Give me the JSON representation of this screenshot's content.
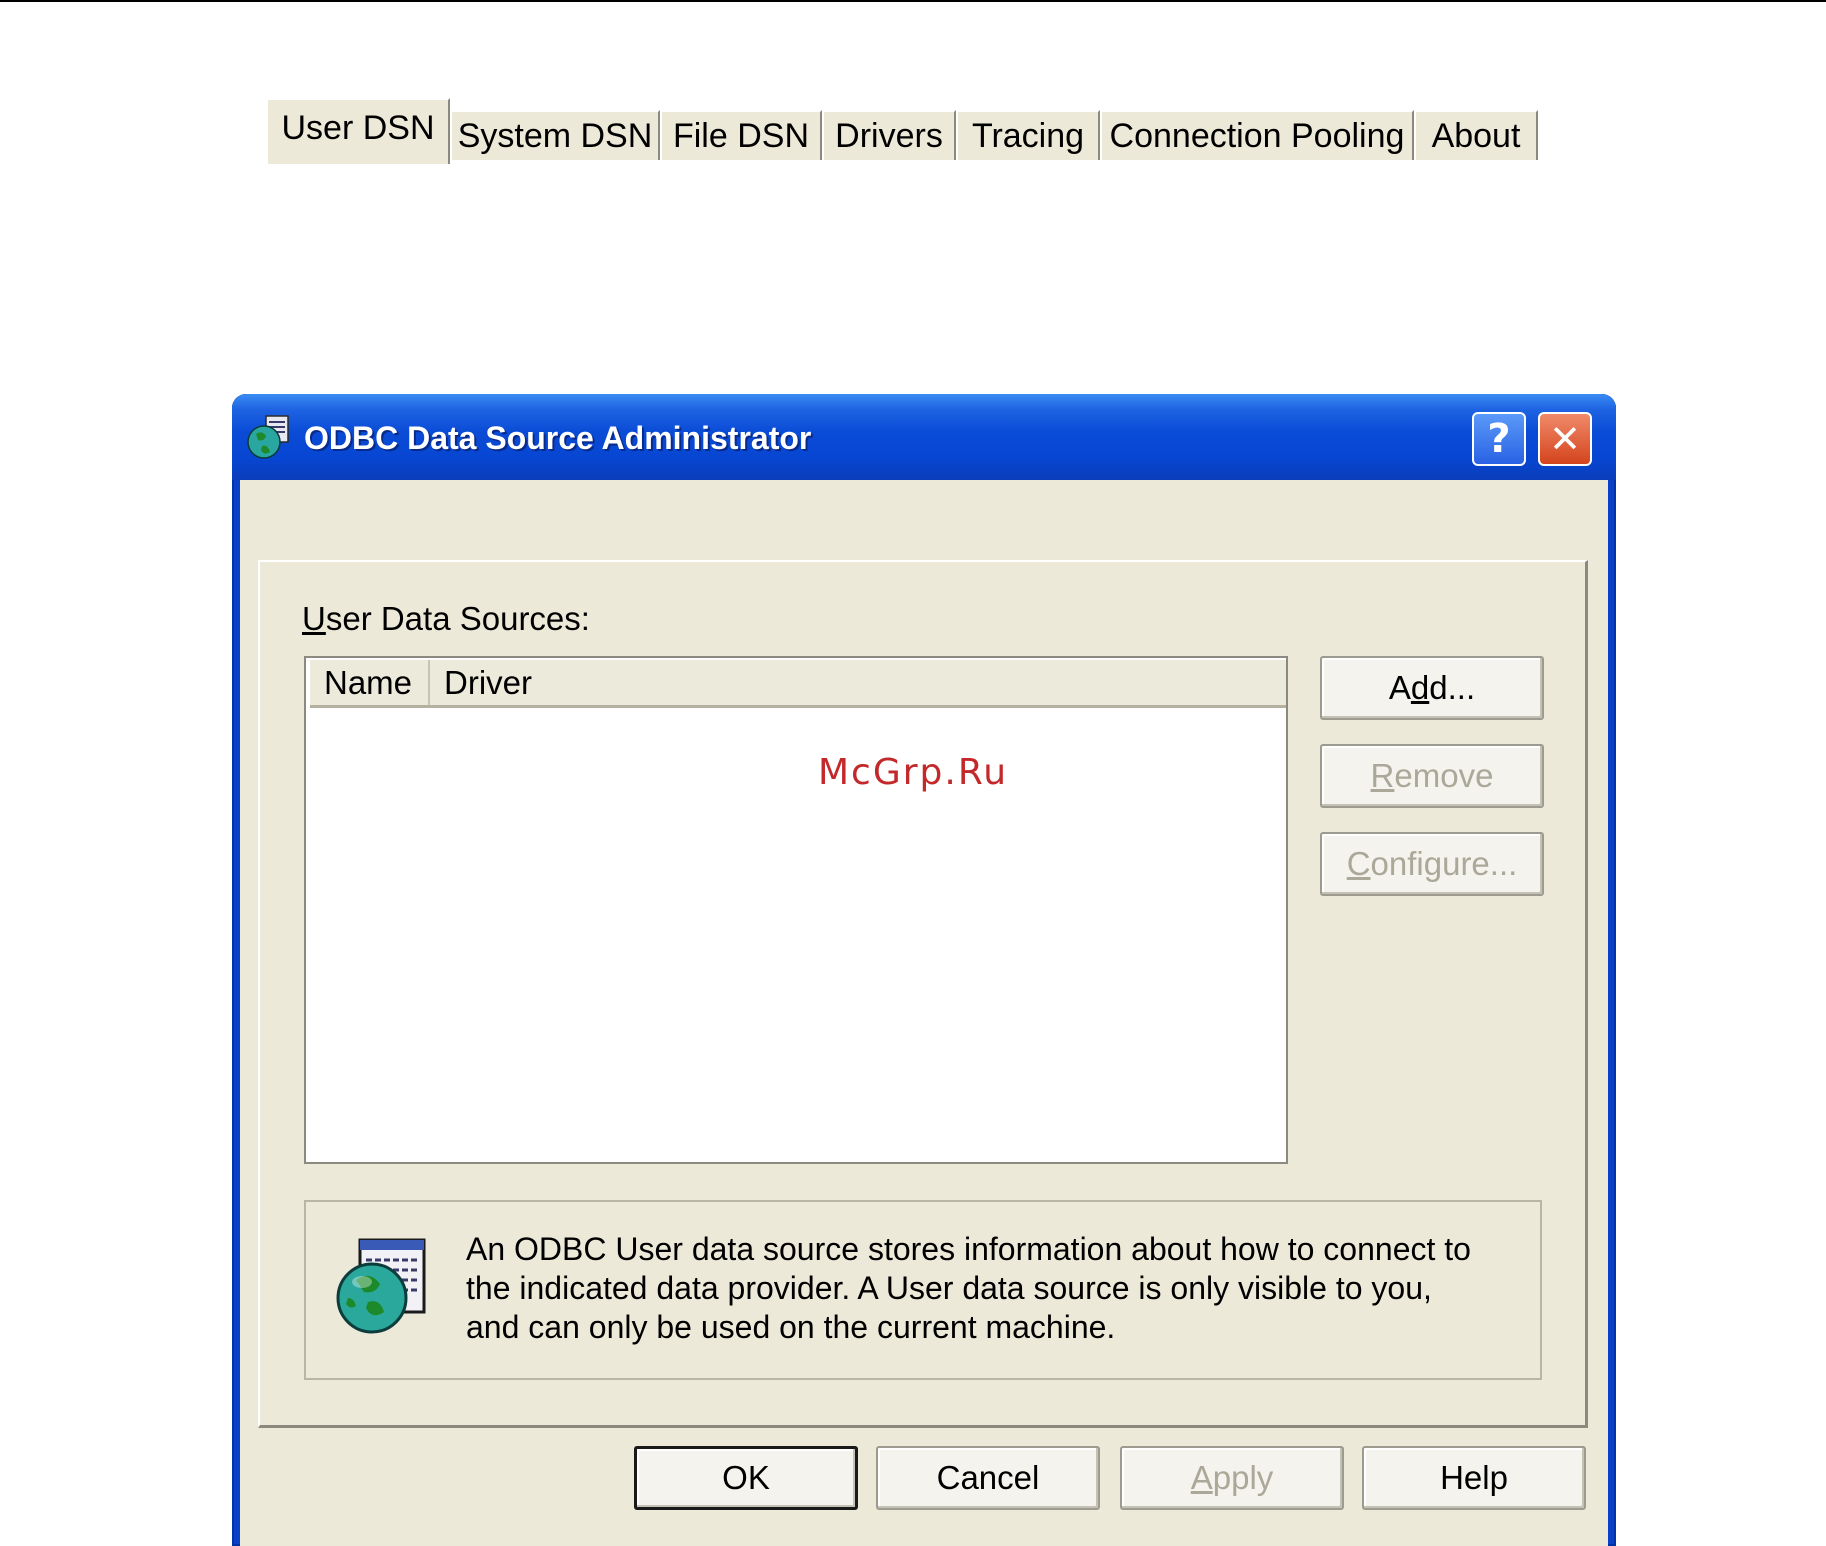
{
  "window": {
    "title": "ODBC Data Source Administrator"
  },
  "titlebar_buttons": {
    "help": "?",
    "close": "✕"
  },
  "tabs": [
    {
      "label": "User DSN",
      "active": true
    },
    {
      "label": "System DSN",
      "active": false
    },
    {
      "label": "File DSN",
      "active": false
    },
    {
      "label": "Drivers",
      "active": false
    },
    {
      "label": "Tracing",
      "active": false
    },
    {
      "label": "Connection Pooling",
      "active": false
    },
    {
      "label": "About",
      "active": false
    }
  ],
  "user_dsn": {
    "group_label_accel": "U",
    "group_label_rest": "ser Data Sources:",
    "columns": [
      "Name",
      "Driver"
    ],
    "rows": [],
    "buttons": {
      "add_pre": "A",
      "add_accel": "d",
      "add_post": "d...",
      "remove_accel": "R",
      "remove_post": "emove",
      "configure_accel": "C",
      "configure_post": "onfigure..."
    },
    "description_lines": [
      "An ODBC User data source stores information about how to connect to",
      "the indicated data provider.   A User data source is only visible to you,",
      "and can only be used on the current machine."
    ]
  },
  "footer_buttons": {
    "ok": "OK",
    "cancel": "Cancel",
    "apply_accel": "A",
    "apply_post": "pply",
    "help": "Help"
  },
  "watermark": "McGrp.Ru",
  "colors": {
    "titlebar": "#0a4bd6",
    "dialog_face": "#ece9d8",
    "close_button": "#d4441c",
    "watermark": "#c3282a"
  },
  "icons": {
    "app": "odbc-globe-icon",
    "info": "odbc-globe-document-icon"
  }
}
